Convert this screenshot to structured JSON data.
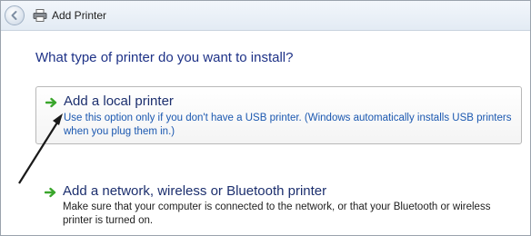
{
  "window": {
    "title": "Add Printer",
    "back_icon": "back-arrow-icon",
    "printer_icon": "printer-icon"
  },
  "question": "What type of printer do you want to install?",
  "options": [
    {
      "title": "Add a local printer",
      "description": "Use this option only if you don't have a USB printer. (Windows automatically installs USB printers when you plug them in.)",
      "icon": "green-arrow-icon",
      "selected": true
    },
    {
      "title": "Add a network, wireless or Bluetooth printer",
      "description": "Make sure that your computer is connected to the network, or that your Bluetooth or wireless printer is turned on.",
      "icon": "green-arrow-icon",
      "selected": false
    }
  ],
  "colors": {
    "link_title": "#1c2f6e",
    "question": "#1e3287",
    "arrow_green": "#3aa62c",
    "titlebar_bg": "#e3ebf4"
  }
}
